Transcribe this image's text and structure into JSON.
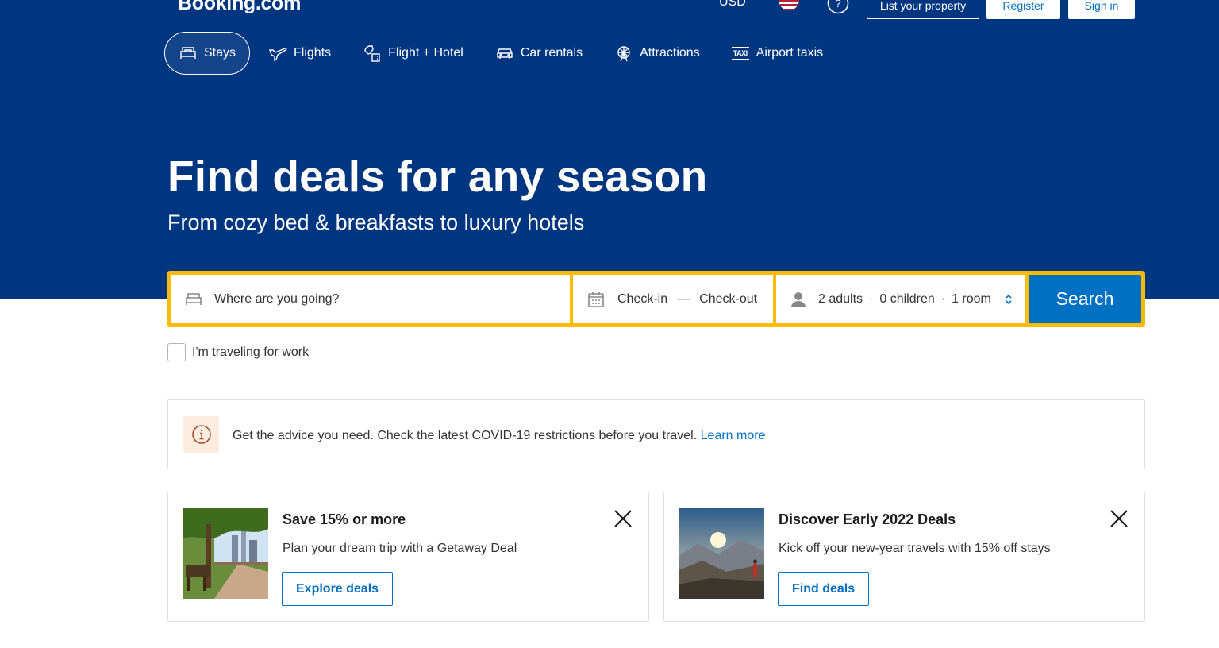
{
  "header": {
    "logo": "Booking.com",
    "currency": "USD",
    "flag_icon": "us-flag-icon",
    "help_icon": "question-circle-icon",
    "list_property": "List your property",
    "register": "Register",
    "sign_in": "Sign in"
  },
  "nav": {
    "items": [
      {
        "label": "Stays",
        "icon": "bed-icon",
        "active": true
      },
      {
        "label": "Flights",
        "icon": "plane-icon",
        "active": false
      },
      {
        "label": "Flight + Hotel",
        "icon": "plane-hotel-icon",
        "active": false
      },
      {
        "label": "Car rentals",
        "icon": "car-icon",
        "active": false
      },
      {
        "label": "Attractions",
        "icon": "ferris-wheel-icon",
        "active": false
      },
      {
        "label": "Airport taxis",
        "icon": "taxi-icon",
        "active": false
      }
    ],
    "taxi_glyph": "TAXI"
  },
  "hero": {
    "title": "Find deals for any season",
    "subtitle": "From cozy bed & breakfasts to luxury hotels"
  },
  "search": {
    "destination_placeholder": "Where are you going?",
    "check_in": "Check-in",
    "date_separator": "—",
    "check_out": "Check-out",
    "adults": "2 adults",
    "children": "0 children",
    "rooms": "1 room",
    "guest_separator": "·",
    "button": "Search"
  },
  "work_travel": {
    "label": "I'm traveling for work",
    "checked": false
  },
  "covid_banner": {
    "text": "Get the advice you need. Check the latest COVID-19 restrictions before you travel.",
    "link": "Learn more"
  },
  "promos": [
    {
      "title": "Save 15% or more",
      "description": "Plan your dream trip with a Getaway Deal",
      "button": "Explore deals"
    },
    {
      "title": "Discover Early 2022 Deals",
      "description": "Kick off your new-year travels with 15% off stays",
      "button": "Find deals"
    }
  ],
  "colors": {
    "brand_blue": "#003580",
    "action_blue": "#0071c2",
    "search_border": "#febb02",
    "white": "#ffffff"
  }
}
